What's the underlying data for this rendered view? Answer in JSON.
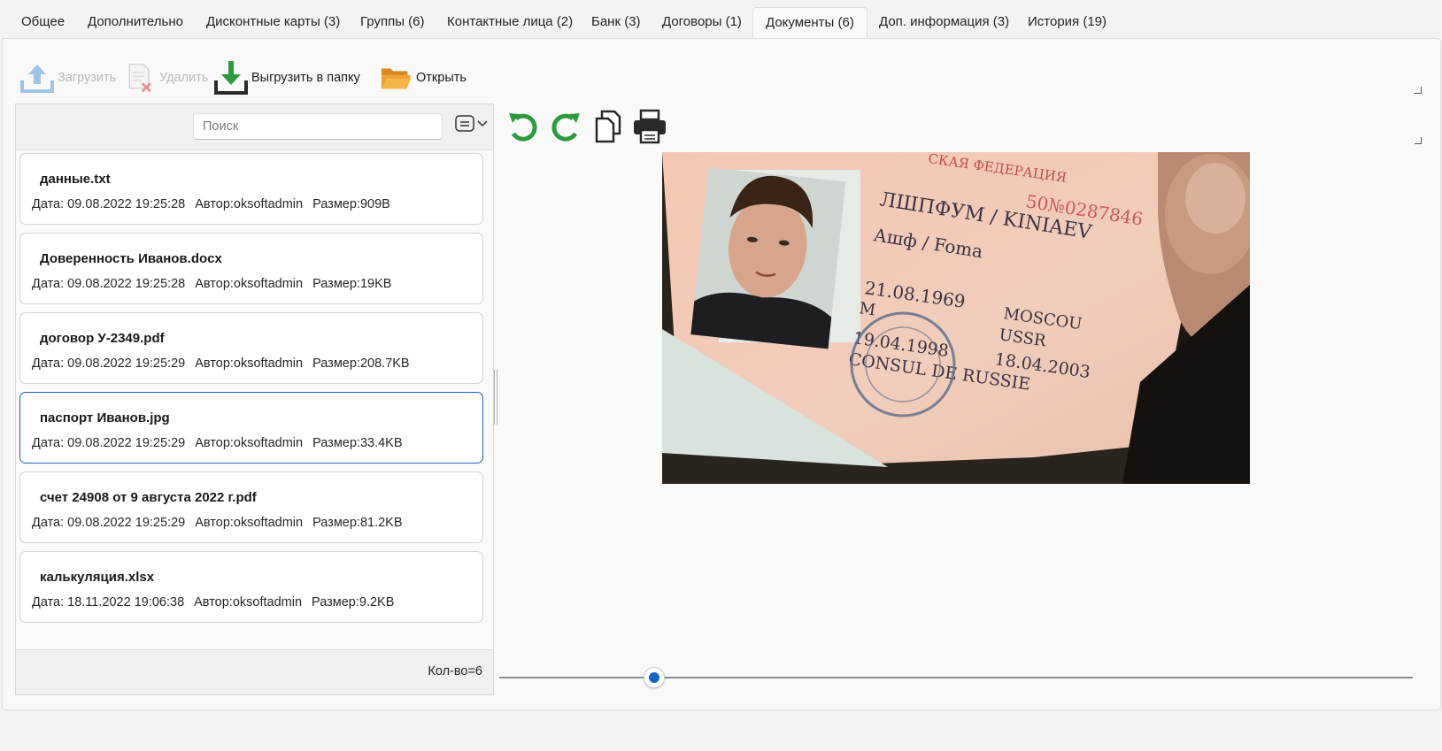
{
  "tabs": [
    {
      "label": "Общее",
      "active": false
    },
    {
      "label": "Дополнительно",
      "active": false
    },
    {
      "label": "Дисконтные карты (3)",
      "active": false
    },
    {
      "label": "Группы (6)",
      "active": false
    },
    {
      "label": "Контактные лица (2)",
      "active": false
    },
    {
      "label": "Банк (3)",
      "active": false
    },
    {
      "label": "Договоры (1)",
      "active": false
    },
    {
      "label": "Документы  (6)",
      "active": true
    },
    {
      "label": "Доп. информация (3)",
      "active": false
    },
    {
      "label": "История (19)",
      "active": false
    }
  ],
  "toolbar": {
    "upload_label": "Загрузить",
    "delete_label": "Удалить",
    "export_label": "Выгрузить в папку",
    "open_label": "Открыть"
  },
  "search": {
    "placeholder": "Поиск",
    "value": ""
  },
  "documents": [
    {
      "name": "данные.txt",
      "date": "Дата: 09.08.2022 19:25:28",
      "author": "Автор:oksoftadmin",
      "size": "Размер:909B",
      "selected": false
    },
    {
      "name": "Доверенность Иванов.docx",
      "date": "Дата: 09.08.2022 19:25:28",
      "author": "Автор:oksoftadmin",
      "size": "Размер:19KB",
      "selected": false
    },
    {
      "name": "договор У-2349.pdf",
      "date": "Дата: 09.08.2022 19:25:29",
      "author": "Автор:oksoftadmin",
      "size": "Размер:208.7KB",
      "selected": false
    },
    {
      "name": "паспорт Иванов.jpg",
      "date": "Дата: 09.08.2022 19:25:29",
      "author": "Автор:oksoftadmin",
      "size": "Размер:33.4KB",
      "selected": true
    },
    {
      "name": "счет 24908 от 9 августа 2022 г.pdf",
      "date": "Дата: 09.08.2022 19:25:29",
      "author": "Автор:oksoftadmin",
      "size": "Размер:81.2KB",
      "selected": false
    },
    {
      "name": "калькуляция.xlsx",
      "date": "Дата: 18.11.2022 19:06:38",
      "author": "Автор:oksoftadmin",
      "size": "Размер:9.2KB",
      "selected": false
    }
  ],
  "footer": {
    "count": "Кол-во=6"
  },
  "viewer": {
    "zoom_fraction": 0.17,
    "photo_text": {
      "header": "СКАЯ ФЕДЕРАЦИЯ",
      "surname": "ЛШПФУМ / KINIAEV",
      "given": "Ашф / Foma",
      "birth": "21.08.1969",
      "sex": "M",
      "place": "MOSCOU",
      "country": "USSR",
      "issued": "19.04.1998",
      "expires": "18.04.2003",
      "consul": "CONSUL DE RUSSIE",
      "number": "50№0287846"
    }
  },
  "colors": {
    "accent": "#1e63b8",
    "green_icon": "#2e9a3e",
    "folder": "#f0a030",
    "upload_disabled": "#9ec3e6"
  }
}
